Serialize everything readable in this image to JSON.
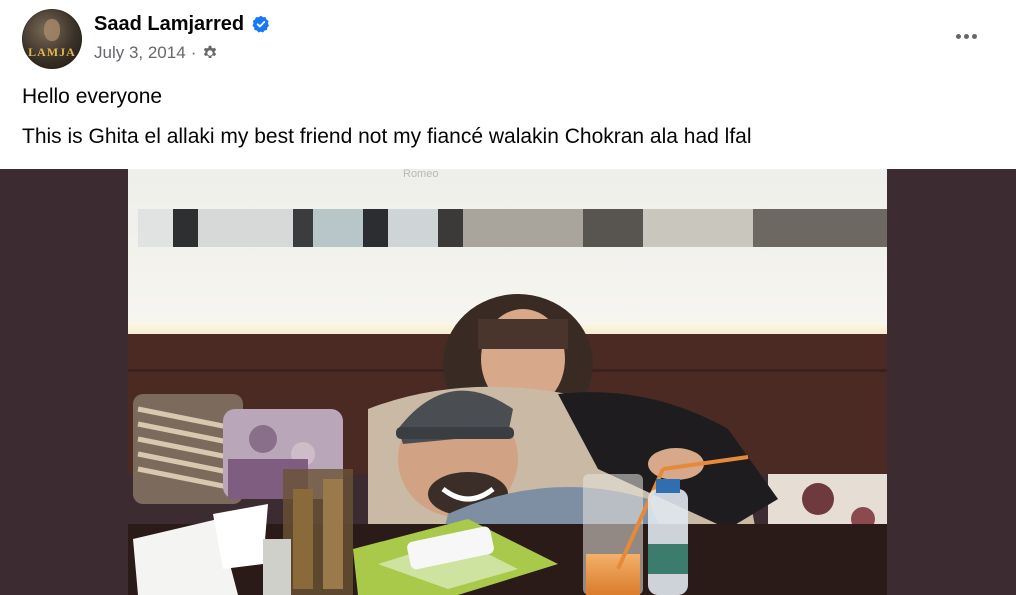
{
  "post": {
    "author": {
      "name": "Saad Lamjarred",
      "verified": true,
      "avatar_icon": "avatar-photo",
      "avatar_text": "LAMJA"
    },
    "date": "July 3, 2014",
    "separator": "·",
    "privacy_icon": "gear-icon",
    "more_icon": "more-horizontal-icon",
    "text_lines": [
      "Hello everyone",
      "This is Ghita el allaki my best friend not my fiancé walakin Chokran ala had lfal"
    ],
    "photo": {
      "icon": "photo",
      "sign_text": "Romeo"
    }
  },
  "colors": {
    "text_primary": "#050505",
    "text_secondary": "#65676b",
    "verified_blue": "#1877f2",
    "photo_letterbox": "#3c2c31"
  }
}
